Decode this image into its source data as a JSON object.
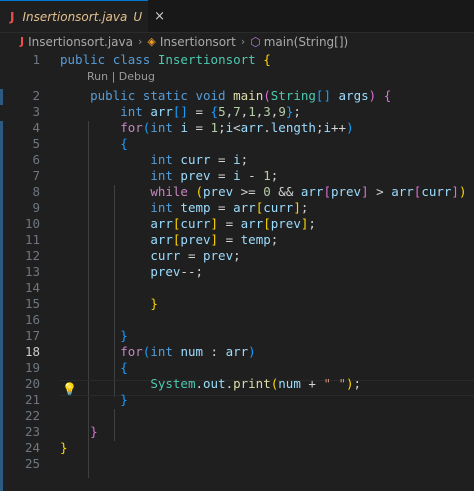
{
  "tab": {
    "filename": "Insertionsort.java",
    "status": "U",
    "icon": "java-icon",
    "close": "×"
  },
  "breadcrumb": {
    "file": "Insertionsort.java",
    "class_name": "Insertionsort",
    "method": "main(String[])"
  },
  "codelens": "Run | Debug",
  "active_line": 18,
  "lines": [
    {
      "n": "1",
      "t": [
        [
          "kw",
          "public"
        ],
        [
          "pl",
          " "
        ],
        [
          "kw",
          "class"
        ],
        [
          "pl",
          " "
        ],
        [
          "ty",
          "Insertionsort"
        ],
        [
          "pl",
          " "
        ],
        [
          "br1",
          "{"
        ]
      ]
    },
    {
      "n": "2",
      "t": [
        [
          "pl",
          "    "
        ],
        [
          "kw",
          "public"
        ],
        [
          "pl",
          " "
        ],
        [
          "kw",
          "static"
        ],
        [
          "pl",
          " "
        ],
        [
          "kw",
          "void"
        ],
        [
          "pl",
          " "
        ],
        [
          "fn",
          "main"
        ],
        [
          "br2",
          "("
        ],
        [
          "ty",
          "String"
        ],
        [
          "br3",
          "[]"
        ],
        [
          "pl",
          " "
        ],
        [
          "var",
          "args"
        ],
        [
          "br2",
          ")"
        ],
        [
          "pl",
          " "
        ],
        [
          "br2",
          "{"
        ]
      ]
    },
    {
      "n": "3",
      "t": [
        [
          "pl",
          "        "
        ],
        [
          "kw",
          "int"
        ],
        [
          "pl",
          " "
        ],
        [
          "var",
          "arr"
        ],
        [
          "br3",
          "[]"
        ],
        [
          "pl",
          " = "
        ],
        [
          "br3",
          "{"
        ],
        [
          "num",
          "5"
        ],
        [
          "pl",
          ","
        ],
        [
          "num",
          "7"
        ],
        [
          "pl",
          ","
        ],
        [
          "num",
          "1"
        ],
        [
          "pl",
          ","
        ],
        [
          "num",
          "3"
        ],
        [
          "pl",
          ","
        ],
        [
          "num",
          "9"
        ],
        [
          "br3",
          "}"
        ],
        [
          "pl",
          ";"
        ]
      ]
    },
    {
      "n": "4",
      "t": [
        [
          "pl",
          "        "
        ],
        [
          "ctl",
          "for"
        ],
        [
          "br3",
          "("
        ],
        [
          "kw",
          "int"
        ],
        [
          "pl",
          " "
        ],
        [
          "var",
          "i"
        ],
        [
          "pl",
          " = "
        ],
        [
          "num",
          "1"
        ],
        [
          "pl",
          ";"
        ],
        [
          "var",
          "i"
        ],
        [
          "pl",
          "<"
        ],
        [
          "var",
          "arr"
        ],
        [
          "pl",
          "."
        ],
        [
          "var",
          "length"
        ],
        [
          "pl",
          ";"
        ],
        [
          "var",
          "i"
        ],
        [
          "pl",
          "++"
        ],
        [
          "br3",
          ")"
        ]
      ]
    },
    {
      "n": "5",
      "t": [
        [
          "pl",
          "        "
        ],
        [
          "br3",
          "{"
        ]
      ]
    },
    {
      "n": "6",
      "t": [
        [
          "pl",
          "            "
        ],
        [
          "kw",
          "int"
        ],
        [
          "pl",
          " "
        ],
        [
          "var",
          "curr"
        ],
        [
          "pl",
          " = "
        ],
        [
          "var",
          "i"
        ],
        [
          "pl",
          ";"
        ]
      ]
    },
    {
      "n": "7",
      "t": [
        [
          "pl",
          "            "
        ],
        [
          "kw",
          "int"
        ],
        [
          "pl",
          " "
        ],
        [
          "var",
          "prev"
        ],
        [
          "pl",
          " = "
        ],
        [
          "var",
          "i"
        ],
        [
          "pl",
          " - "
        ],
        [
          "num",
          "1"
        ],
        [
          "pl",
          ";"
        ]
      ]
    },
    {
      "n": "8",
      "t": [
        [
          "pl",
          "            "
        ],
        [
          "ctl",
          "while"
        ],
        [
          "pl",
          " "
        ],
        [
          "br1",
          "("
        ],
        [
          "var",
          "prev"
        ],
        [
          "pl",
          " >= "
        ],
        [
          "num",
          "0"
        ],
        [
          "pl",
          " && "
        ],
        [
          "var",
          "arr"
        ],
        [
          "br2",
          "["
        ],
        [
          "var",
          "prev"
        ],
        [
          "br2",
          "]"
        ],
        [
          "pl",
          " > "
        ],
        [
          "var",
          "arr"
        ],
        [
          "br2",
          "["
        ],
        [
          "var",
          "curr"
        ],
        [
          "br2",
          "]"
        ],
        [
          "br1",
          ")"
        ],
        [
          "pl",
          " "
        ],
        [
          "br1",
          "{"
        ]
      ]
    },
    {
      "n": "9",
      "t": [
        [
          "pl",
          "            "
        ],
        [
          "kw",
          "int"
        ],
        [
          "pl",
          " "
        ],
        [
          "var",
          "temp"
        ],
        [
          "pl",
          " = "
        ],
        [
          "var",
          "arr"
        ],
        [
          "br1",
          "["
        ],
        [
          "var",
          "curr"
        ],
        [
          "br1",
          "]"
        ],
        [
          "pl",
          ";"
        ]
      ]
    },
    {
      "n": "10",
      "t": [
        [
          "pl",
          "            "
        ],
        [
          "var",
          "arr"
        ],
        [
          "br1",
          "["
        ],
        [
          "var",
          "curr"
        ],
        [
          "br1",
          "]"
        ],
        [
          "pl",
          " = "
        ],
        [
          "var",
          "arr"
        ],
        [
          "br1",
          "["
        ],
        [
          "var",
          "prev"
        ],
        [
          "br1",
          "]"
        ],
        [
          "pl",
          ";"
        ]
      ]
    },
    {
      "n": "11",
      "t": [
        [
          "pl",
          "            "
        ],
        [
          "var",
          "arr"
        ],
        [
          "br1",
          "["
        ],
        [
          "var",
          "prev"
        ],
        [
          "br1",
          "]"
        ],
        [
          "pl",
          " = "
        ],
        [
          "var",
          "temp"
        ],
        [
          "pl",
          ";"
        ]
      ]
    },
    {
      "n": "12",
      "t": [
        [
          "pl",
          "            "
        ],
        [
          "var",
          "curr"
        ],
        [
          "pl",
          " = "
        ],
        [
          "var",
          "prev"
        ],
        [
          "pl",
          ";"
        ]
      ]
    },
    {
      "n": "13",
      "t": [
        [
          "pl",
          "            "
        ],
        [
          "var",
          "prev"
        ],
        [
          "pl",
          "--;"
        ]
      ]
    },
    {
      "n": "14",
      "t": []
    },
    {
      "n": "15",
      "t": [
        [
          "pl",
          "            "
        ],
        [
          "br1",
          "}"
        ]
      ]
    },
    {
      "n": "16",
      "t": []
    },
    {
      "n": "17",
      "t": [
        [
          "pl",
          "        "
        ],
        [
          "br3",
          "}"
        ]
      ]
    },
    {
      "n": "18",
      "t": [
        [
          "pl",
          "        "
        ],
        [
          "ctl",
          "for"
        ],
        [
          "br3",
          "("
        ],
        [
          "kw",
          "int"
        ],
        [
          "pl",
          " "
        ],
        [
          "var",
          "num"
        ],
        [
          "pl",
          " : "
        ],
        [
          "var",
          "arr"
        ],
        [
          "br3",
          ")"
        ]
      ]
    },
    {
      "n": "19",
      "t": [
        [
          "pl",
          "        "
        ],
        [
          "br3",
          "{"
        ]
      ]
    },
    {
      "n": "20",
      "t": [
        [
          "pl",
          "            "
        ],
        [
          "ty",
          "System"
        ],
        [
          "pl",
          "."
        ],
        [
          "var",
          "out"
        ],
        [
          "pl",
          "."
        ],
        [
          "fn",
          "print"
        ],
        [
          "br1",
          "("
        ],
        [
          "var",
          "num"
        ],
        [
          "pl",
          " + "
        ],
        [
          "str",
          "\" \""
        ],
        [
          "br1",
          ")"
        ],
        [
          "pl",
          ";"
        ]
      ]
    },
    {
      "n": "21",
      "t": [
        [
          "pl",
          "        "
        ],
        [
          "br3",
          "}"
        ]
      ]
    },
    {
      "n": "22",
      "t": []
    },
    {
      "n": "23",
      "t": [
        [
          "pl",
          "    "
        ],
        [
          "br2",
          "}"
        ]
      ]
    },
    {
      "n": "24",
      "t": [
        [
          "br1",
          "}"
        ]
      ]
    },
    {
      "n": "25",
      "t": []
    }
  ]
}
